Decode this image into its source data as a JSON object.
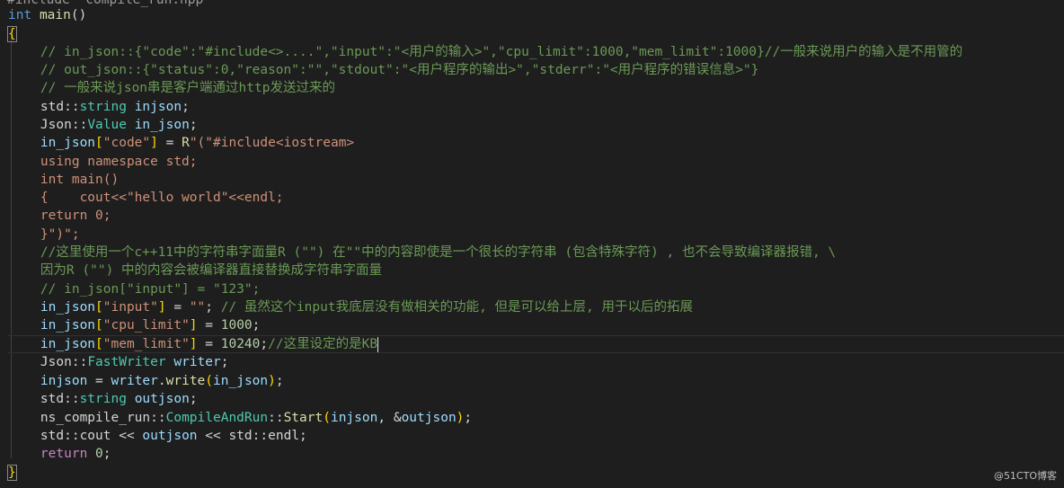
{
  "editor": {
    "top_partial": "#include \"compile_run.hpp\"",
    "lines": {
      "l01_kw": "int",
      "l01_fn": "main",
      "l01_rest": "()",
      "l02_brace": "{",
      "l03": "    // in_json::{\"code\":\"#include<>....\",\"input\":\"<用户的输入>\",\"cpu_limit\":1000,\"mem_limit\":1000}//一般来说用户的输入是不用管的",
      "l04": "    // out_json::{\"status\":0,\"reason\":\"\",\"stdout\":\"<用户程序的输出>\",\"stderr\":\"<用户程序的错误信息>\"}",
      "l05": "    // 一般来说json串是客户端通过http发送过来的",
      "l06_ns": "    std",
      "l06_op": "::",
      "l06_type": "string",
      "l06_var": " injson",
      "l06_end": ";",
      "l07_ns": "    Json",
      "l07_op": "::",
      "l07_type": "Value",
      "l07_var": " in_json",
      "l07_end": ";",
      "l08_var": "    in_json",
      "l08_br": "[",
      "l08_str": "\"code\"",
      "l08_br2": "]",
      "l08_eq": " = ",
      "l08_r": "R",
      "l08_rest": "\"(\"#include<iostream>",
      "l09": "    using namespace std;",
      "l10": "    int main()",
      "l11": "    {    cout<<\"hello world\"<<endl;",
      "l12": "    return 0;",
      "l13": "    }\")\";",
      "l14": "    //这里使用一个c++11中的字符串字面量R (\"\") 在\"\"中的内容即使是一个很长的字符串 (包含特殊字符) , 也不会导致编译器报错, \\",
      "l15": "    因为R (\"\") 中的内容会被编译器直接替换成字符串字面量",
      "l16": "    // in_json[\"input\"] = \"123\";",
      "l17_var": "    in_json",
      "l17_key": "\"input\"",
      "l17_val": "\"\"",
      "l17_cm": " // 虽然这个input我底层没有做相关的功能, 但是可以给上层, 用于以后的拓展",
      "l18_var": "    in_json",
      "l18_key": "\"cpu_limit\"",
      "l18_num": "1000",
      "l19_var": "    in_json",
      "l19_key": "\"mem_limit\"",
      "l19_num": "10240",
      "l19_cm": "//这里设定的是KB",
      "l20_ns": "    Json",
      "l20_type": "FastWriter",
      "l20_var": " writer",
      "l21_var": "    injson",
      "l21_obj": "writer",
      "l21_fn": "write",
      "l21_arg": "in_json",
      "l22_ns": "    std",
      "l22_type": "string",
      "l22_var": " outjson",
      "l23_ns1": "    ns_compile_run",
      "l23_ns2": "CompileAndRun",
      "l23_fn": "Start",
      "l23_a1": "injson",
      "l23_a2": "outjson",
      "l24_a": "    std",
      "l24_b": "cout",
      "l24_c": "outjson",
      "l24_d": "std",
      "l24_e": "endl",
      "l25_kw": "    return",
      "l25_num": "0",
      "l26_brace": "}"
    }
  },
  "watermark": "@51CTO博客",
  "colors": {
    "background": "#1e1e1e",
    "keyword": "#569cd6",
    "type": "#4ec9b0",
    "function": "#dcdcaa",
    "variable": "#9cdcfe",
    "string": "#ce9178",
    "number": "#b5cea8",
    "comment": "#6a9955"
  }
}
